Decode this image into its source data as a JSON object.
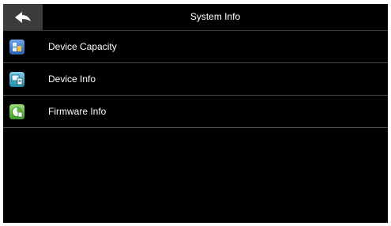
{
  "header": {
    "title": "System Info",
    "back_icon": "back-arrow-icon"
  },
  "menu": {
    "items": [
      {
        "label": "Device Capacity",
        "icon": "device-capacity-icon"
      },
      {
        "label": "Device Info",
        "icon": "device-info-icon"
      },
      {
        "label": "Firmware Info",
        "icon": "firmware-info-icon"
      }
    ]
  },
  "colors": {
    "background": "#000000",
    "header_button": "#3c3c3c",
    "divider": "#4a4a4a",
    "text": "#ffffff"
  }
}
